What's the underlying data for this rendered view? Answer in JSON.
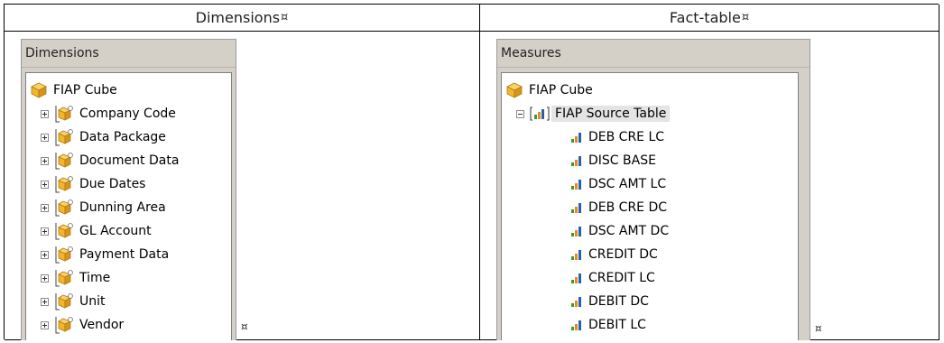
{
  "headers": {
    "left": "Dimensions",
    "right": "Fact-table",
    "mark": "¤"
  },
  "dimensions_panel": {
    "title": "Dimensions",
    "root": "FIAP Cube",
    "items": [
      {
        "label": "Company Code"
      },
      {
        "label": "Data Package"
      },
      {
        "label": "Document Data"
      },
      {
        "label": "Due Dates"
      },
      {
        "label": "Dunning Area"
      },
      {
        "label": "GL Account"
      },
      {
        "label": "Payment Data"
      },
      {
        "label": "Time"
      },
      {
        "label": "Unit"
      },
      {
        "label": "Vendor"
      }
    ]
  },
  "measures_panel": {
    "title": "Measures",
    "root": "FIAP Cube",
    "group": "FIAP Source Table",
    "items": [
      {
        "label": "DEB CRE LC"
      },
      {
        "label": "DISC BASE"
      },
      {
        "label": "DSC AMT LC"
      },
      {
        "label": "DEB CRE DC"
      },
      {
        "label": "DSC AMT DC"
      },
      {
        "label": "CREDIT DC"
      },
      {
        "label": "CREDIT LC"
      },
      {
        "label": "DEBIT DC"
      },
      {
        "label": "DEBIT LC"
      }
    ]
  },
  "colors": {
    "panel_bg": "#d4d0c8",
    "cube": "#f2b62a",
    "bar_green": "#3c9a2b",
    "bar_orange": "#e58a1f",
    "bar_blue": "#2a5fb0"
  }
}
